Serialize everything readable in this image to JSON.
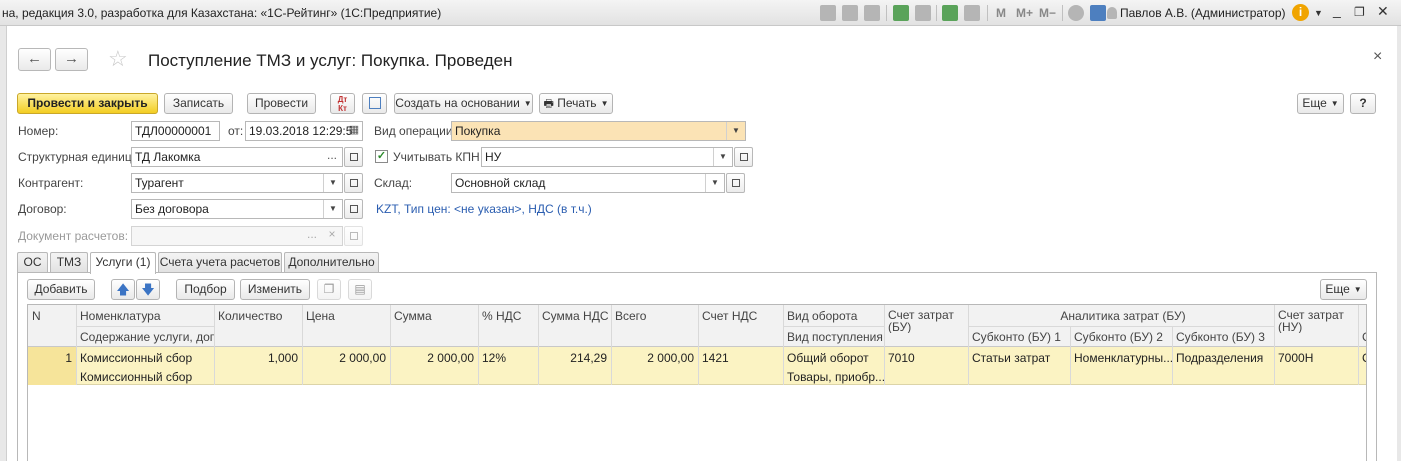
{
  "window": {
    "app_title": "на, редакция 3.0, разработка для Казахстана: «1С-Рейтинг»  (1С:Предприятие)",
    "user": "Павлов А.В. (Администратор)",
    "toolbar_letters": {
      "m": "M",
      "m_plus": "M+",
      "m_minus": "M−"
    }
  },
  "header": {
    "title": "Поступление ТМЗ и услуг: Покупка. Проведен",
    "back_icon": "←",
    "forward_icon": "→",
    "close": "×"
  },
  "commands": {
    "post_close": "Провести и закрыть",
    "save": "Записать",
    "post": "Провести",
    "dtkt_top": "Дт",
    "dtkt_bottom": "Кт",
    "create_based": "Создать на основании",
    "print": "Печать",
    "more": "Еще",
    "help": "?"
  },
  "form": {
    "number_label": "Номер:",
    "number": "ТДЛ00000001",
    "date_label": "от:",
    "date": "19.03.2018 12:29:5",
    "operation_label": "Вид операции:",
    "operation": "Покупка",
    "unit_label": "Структурная единица:",
    "unit": "ТД Лакомка",
    "kpn_label": "Учитывать КПН",
    "kpn": "НУ",
    "counterparty_label": "Контрагент:",
    "counterparty": "Турагент",
    "warehouse_label": "Склад:",
    "warehouse": "Основной склад",
    "contract_label": "Договор:",
    "contract": "Без договора",
    "prices_link": "KZT, Тип цен: <не указан>, НДС (в т.ч.)",
    "settlement_doc_label": "Документ расчетов:"
  },
  "tabs": [
    "ОС",
    "ТМЗ",
    "Услуги (1)",
    "Счета учета расчетов",
    "Дополнительно"
  ],
  "table_toolbar": {
    "add": "Добавить",
    "pick": "Подбор",
    "change": "Изменить",
    "more": "Еще"
  },
  "table": {
    "headers": {
      "n": "N",
      "nomenclature": "Номенклатура",
      "content": "Содержание услуги, доп.",
      "qty": "Количество",
      "price": "Цена",
      "sum": "Сумма",
      "vat_rate": "% НДС",
      "vat_sum": "Сумма НДС",
      "total": "Всего",
      "vat_account": "Счет НДС",
      "turnover_type": "Вид оборота",
      "receipt_type": "Вид поступления",
      "cost_account": "Счет затрат (БУ)",
      "analytics": "Аналитика затрат (БУ)",
      "sub1": "Субконто (БУ) 1",
      "sub2": "Субконто (БУ) 2",
      "sub3": "Субконто (БУ) 3",
      "cost_account_nu": "Счет затрат (НУ)",
      "cut": "С"
    },
    "rows": [
      {
        "n": "1",
        "nomenclature": "Комиссионный сбор",
        "content": "Комиссионный сбор",
        "qty": "1,000",
        "price": "2 000,00",
        "sum": "2 000,00",
        "vat_rate": "12%",
        "vat_sum": "214,29",
        "total": "2 000,00",
        "vat_account": "1421",
        "turnover_type": "Общий оборот",
        "receipt_type": "Товары, приобр...",
        "cost_account": "7010",
        "sub1": "Статьи затрат",
        "sub2": "Номенклатурны...",
        "sub3": "Подразделения",
        "cost_account_nu": "7000Н",
        "cut": "С"
      }
    ]
  }
}
